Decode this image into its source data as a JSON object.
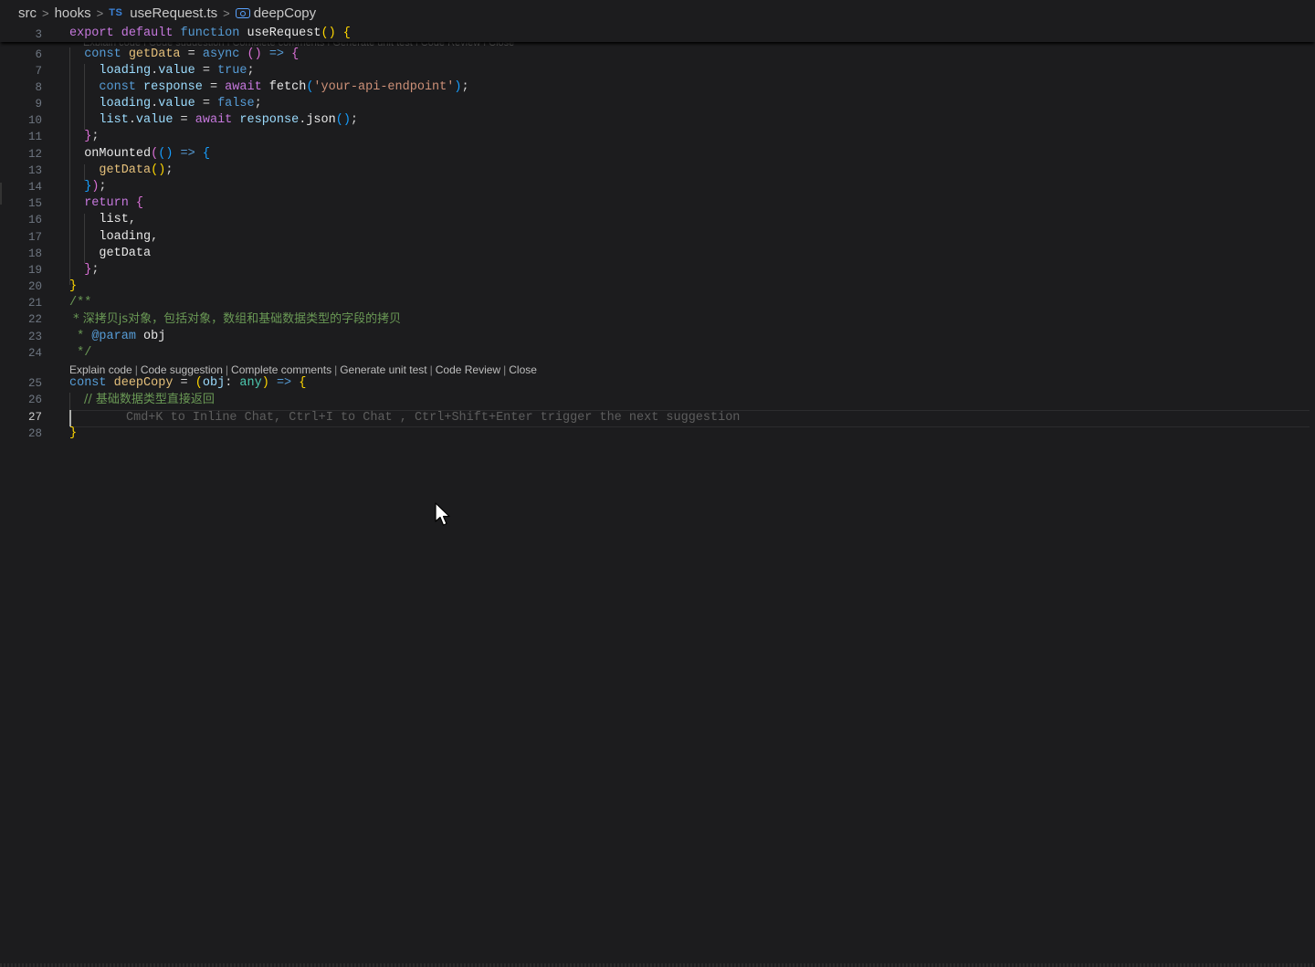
{
  "breadcrumb": {
    "items": [
      "src",
      "hooks",
      "useRequest.ts",
      "deepCopy"
    ],
    "separator": ">",
    "ts_badge": "TS"
  },
  "sticky": {
    "line_number": "3",
    "peek_text": "Explain code | Code suggestion | Complete comments | Generate unit test | Code Review | Close"
  },
  "line_numbers": [
    "6",
    "7",
    "8",
    "9",
    "10",
    "11",
    "12",
    "13",
    "14",
    "15",
    "16",
    "17",
    "18",
    "19",
    "20",
    "21",
    "22",
    "23",
    "24",
    "25",
    "26",
    "27",
    "28"
  ],
  "comment": {
    "l22": " * 深拷贝js对象，包括对象，数组和基础数据类型的字段的拷贝",
    "l26": "// 基础数据类型直接返回"
  },
  "codelens": {
    "items": [
      "Explain code",
      "Code suggestion",
      "Complete comments",
      "Generate unit test",
      "Code Review",
      "Close"
    ]
  },
  "ghost_text": "Cmd+K to Inline Chat, Ctrl+I to Chat , Ctrl+Shift+Enter trigger the next suggestion",
  "colors": {
    "background": "#1c1c1e",
    "keyword": "#c678dd",
    "string": "#ce9178",
    "comment": "#6a9955",
    "variable": "#9cdcfe"
  },
  "icons": {
    "symbol": "symbol-variable-icon",
    "pointer": "mouse-pointer-icon",
    "chevron": "chevron-right-icon"
  }
}
